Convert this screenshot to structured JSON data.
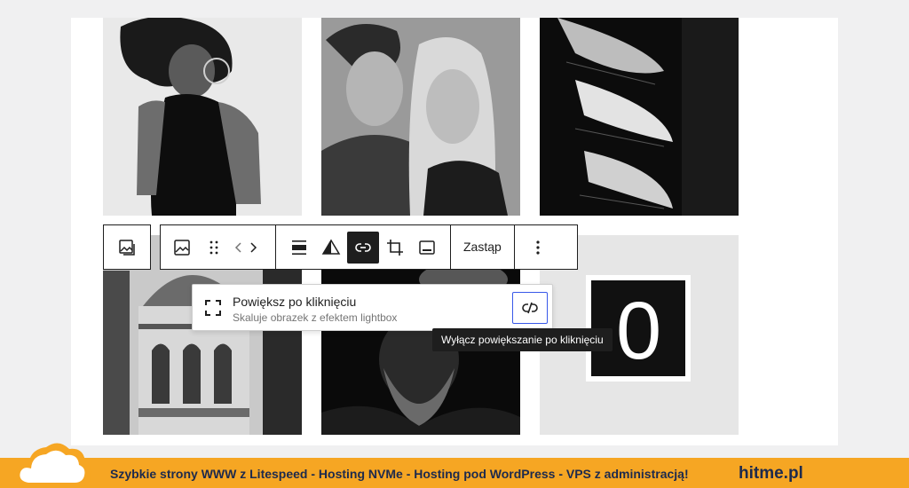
{
  "toolbar": {
    "replace_label": "Zastąp",
    "buttons": [
      "image-block",
      "image",
      "drag",
      "move-arrows",
      "align",
      "duotone",
      "link",
      "crop",
      "caption",
      "more"
    ]
  },
  "popover": {
    "title": "Powiększ po kliknięciu",
    "subtitle": "Skaluje obrazek z efektem lightbox",
    "tooltip": "Wyłącz powiększanie po kliknięciu"
  },
  "gallery": {
    "sign_digit": "0"
  },
  "footer": {
    "text": "Szybkie strony WWW z Litespeed - Hosting  NVMe - Hosting pod WordPress - VPS z administracją!",
    "brand": "hitme.pl"
  },
  "colors": {
    "accent": "#3858e9",
    "footer_bg": "#f6a623",
    "footer_text": "#1d2a4d",
    "dark": "#1e1e1e"
  }
}
